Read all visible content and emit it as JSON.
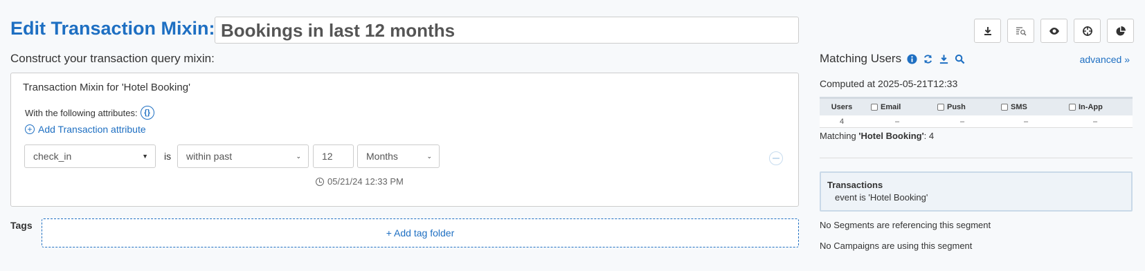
{
  "header": {
    "label": "Edit Transaction Mixin:",
    "name_value": "Bookings in last 12 months"
  },
  "toolbar": {
    "buttons": [
      "download-icon",
      "search-list-icon",
      "eye-icon",
      "crosshair-icon",
      "pie-chart-icon"
    ]
  },
  "builder": {
    "subtitle": "Construct your transaction query mixin:",
    "panel_title": "Transaction Mixin for 'Hotel Booking'",
    "attributes_label": "With the following attributes:",
    "attributes_icon": "{}",
    "add_attribute_label": "Add Transaction attribute",
    "condition": {
      "field": "check_in",
      "operator_word": "is",
      "operator": "within past",
      "amount": "12",
      "unit": "Months"
    },
    "timestamp": "05/21/24 12:33 PM"
  },
  "tags": {
    "label": "Tags",
    "add_label": "+ Add tag folder"
  },
  "sidebar": {
    "title": "Matching Users",
    "advanced": "advanced »",
    "computed": "Computed at 2025-05-21T12:33",
    "table": {
      "headers": [
        "Users",
        "Email",
        "Push",
        "SMS",
        "In-App"
      ],
      "row": [
        "4",
        "–",
        "–",
        "–",
        "–"
      ]
    },
    "matching_prefix": "Matching ",
    "matching_name": "'Hotel Booking'",
    "matching_suffix": ": 4",
    "transactions_title": "Transactions",
    "transactions_line": "event is 'Hotel Booking'",
    "no_segments": "No Segments are referencing this segment",
    "no_campaigns": "No Campaigns are using this segment"
  },
  "colors": {
    "accent": "#1e6fc2",
    "background": "#f7f9fb"
  }
}
